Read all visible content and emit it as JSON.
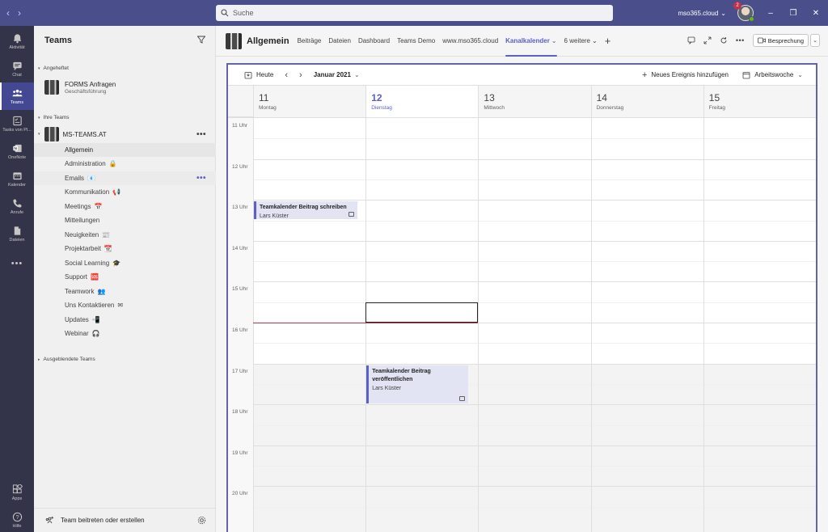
{
  "titlebar": {
    "search_placeholder": "Suche",
    "tenant": "mso365.cloud",
    "notification_count": "2"
  },
  "rail": {
    "items": [
      {
        "label": "Aktivität",
        "icon": "bell-icon"
      },
      {
        "label": "Chat",
        "icon": "chat-icon"
      },
      {
        "label": "Teams",
        "icon": "teams-icon"
      },
      {
        "label": "Tasks von Pl...",
        "icon": "tasks-icon"
      },
      {
        "label": "OneNote",
        "icon": "onenote-icon"
      },
      {
        "label": "Kalender",
        "icon": "calendar-icon"
      },
      {
        "label": "Anrufe",
        "icon": "phone-icon"
      },
      {
        "label": "Dateien",
        "icon": "files-icon"
      },
      {
        "label": "Apps",
        "icon": "apps-icon"
      },
      {
        "label": "Hilfe",
        "icon": "help-icon"
      }
    ]
  },
  "panel": {
    "title": "Teams",
    "pinned_label": "Angeheftet",
    "pinned": {
      "name": "FORMS Anfragen",
      "sub": "Geschäftsführung"
    },
    "your_teams_label": "Ihre Teams",
    "team_name": "MS-TEAMS.AT",
    "channels": [
      {
        "name": "Allgemein",
        "emoji": ""
      },
      {
        "name": "Administration",
        "emoji": "🔒"
      },
      {
        "name": "Emails",
        "emoji": "📧"
      },
      {
        "name": "Kommunikation",
        "emoji": "📢"
      },
      {
        "name": "Meetings",
        "emoji": "📅"
      },
      {
        "name": "Mitteilungen",
        "emoji": ""
      },
      {
        "name": "Neuigkeiten",
        "emoji": "📰"
      },
      {
        "name": "Projektarbeit",
        "emoji": "📆"
      },
      {
        "name": "Social Learning",
        "emoji": "🎓"
      },
      {
        "name": "Support",
        "emoji": "🆘"
      },
      {
        "name": "Teamwork",
        "emoji": "👥"
      },
      {
        "name": "Uns Kontaktieren",
        "emoji": "✉"
      },
      {
        "name": "Updates",
        "emoji": "📲"
      },
      {
        "name": "Webinar",
        "emoji": "🎧"
      }
    ],
    "hidden_teams_label": "Ausgeblendete Teams",
    "footer_label": "Team beitreten oder erstellen"
  },
  "header": {
    "channel_title": "Allgemein",
    "tabs": [
      "Beiträge",
      "Dateien",
      "Dashboard",
      "Teams Demo",
      "www.mso365.cloud",
      "Kanalkalender",
      "6 weitere"
    ],
    "active_tab": "Kanalkalender",
    "meeting_label": "Besprechung"
  },
  "calendar": {
    "today_label": "Heute",
    "month_label": "Januar 2021",
    "add_event_label": "Neues Ereignis hinzufügen",
    "view_label": "Arbeitswoche",
    "days": [
      {
        "num": "11",
        "name": "Montag"
      },
      {
        "num": "12",
        "name": "Dienstag"
      },
      {
        "num": "13",
        "name": "Mittwoch"
      },
      {
        "num": "14",
        "name": "Donnerstag"
      },
      {
        "num": "15",
        "name": "Freitag"
      }
    ],
    "today_index": 1,
    "hours": [
      "11 Uhr",
      "12 Uhr",
      "13 Uhr",
      "14 Uhr",
      "15 Uhr",
      "16 Uhr",
      "17 Uhr",
      "18 Uhr",
      "19 Uhr",
      "20 Uhr"
    ],
    "events": [
      {
        "title": "Teamkalender Beitrag schreiben",
        "organizer": "Lars Küster",
        "day": "Montag",
        "start": "13:00",
        "end": "13:30"
      },
      {
        "title": "Teamkalender Beitrag veröffentlichen",
        "organizer": "Lars Küster",
        "day": "Dienstag",
        "start": "17:00",
        "end": "18:00"
      }
    ],
    "accent": "#5b5fc7"
  }
}
